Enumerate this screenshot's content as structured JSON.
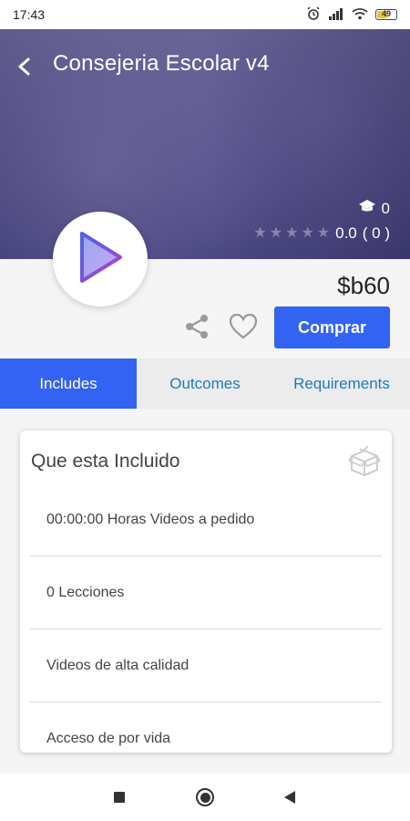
{
  "status_bar": {
    "time": "17:43",
    "battery_level": "49"
  },
  "hero": {
    "title": "Consejeria Escolar v4",
    "students_count": "0",
    "rating_value": "0.0",
    "rating_count": "( 0 )",
    "stars": 5
  },
  "actions": {
    "price": "$b60",
    "buy_label": "Comprar"
  },
  "tabs": [
    {
      "label": "Includes",
      "active": true
    },
    {
      "label": "Outcomes",
      "active": false
    },
    {
      "label": "Requirements",
      "active": false
    }
  ],
  "includes_card": {
    "title": "Que esta Incluido",
    "items": [
      "00:00:00 Horas Videos a pedido",
      "0 Lecciones",
      "Videos de alta calidad",
      "Acceso de por vida"
    ]
  },
  "colors": {
    "accent": "#3363f2",
    "tab_text": "#1f7ab8",
    "hero": "#5a5690"
  },
  "icons": {
    "back": "back-arrow-icon",
    "students": "graduation-cap-icon",
    "star": "star-icon",
    "play": "play-icon",
    "share": "share-icon",
    "wishlist": "heart-icon",
    "included": "box-icon",
    "nav_recents": "square-icon",
    "nav_home": "circle-icon",
    "nav_back": "triangle-back-icon"
  }
}
